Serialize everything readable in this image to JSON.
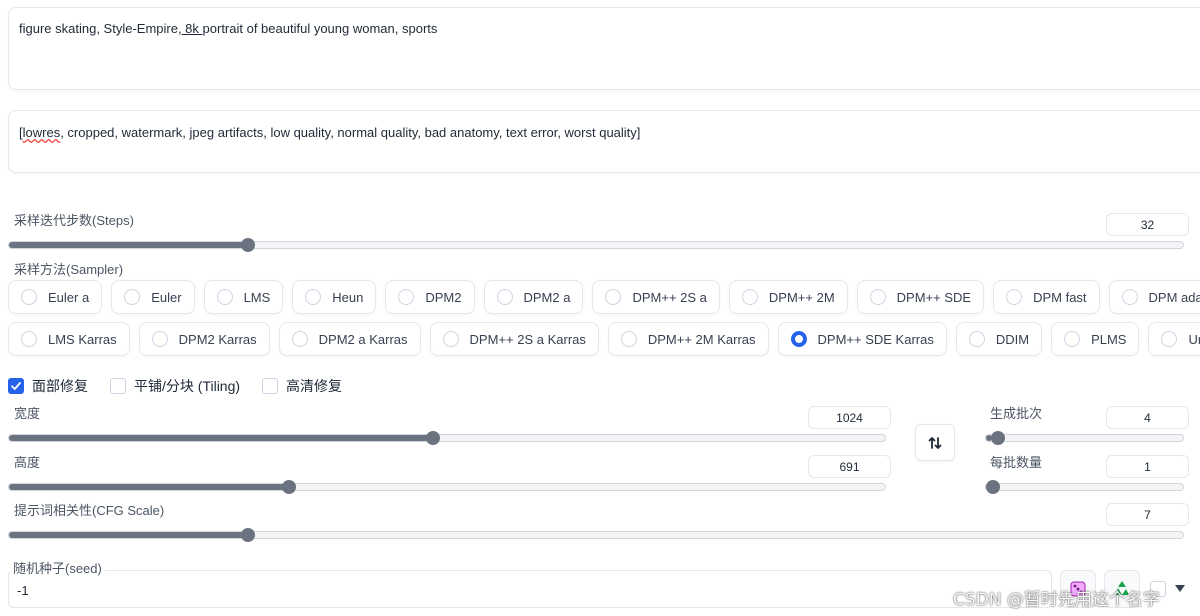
{
  "prompt": {
    "pre": "figure skating, Style-Empire",
    "underlined": ", 8k ",
    "post": "portrait of beautiful young woman, sports"
  },
  "negative_prompt": {
    "pre": "[",
    "misspelled": "lowres",
    "post": ", cropped, watermark, jpeg artifacts, low quality, normal quality, bad anatomy, text error, worst quality]"
  },
  "steps": {
    "label": "采样迭代步数(Steps)",
    "value": "32",
    "fraction": 0.2
  },
  "sampler": {
    "label": "采样方法(Sampler)",
    "selected": "DPM++ SDE Karras",
    "row1": [
      "Euler a",
      "Euler",
      "LMS",
      "Heun",
      "DPM2",
      "DPM2 a",
      "DPM++ 2S a",
      "DPM++ 2M",
      "DPM++ SDE",
      "DPM fast",
      "DPM adaptive"
    ],
    "row2": [
      "LMS Karras",
      "DPM2 Karras",
      "DPM2 a Karras",
      "DPM++ 2S a Karras",
      "DPM++ 2M Karras",
      "DPM++ SDE Karras",
      "DDIM",
      "PLMS",
      "UniPC"
    ]
  },
  "options": {
    "face_restore": {
      "label": "面部修复",
      "checked": true
    },
    "tiling": {
      "label": "平铺/分块 (Tiling)",
      "checked": false
    },
    "hires_fix": {
      "label": "高清修复",
      "checked": false
    }
  },
  "width": {
    "label": "宽度",
    "value": "1024",
    "fraction": 0.484
  },
  "height": {
    "label": "高度",
    "value": "691",
    "fraction": 0.317
  },
  "batch_count": {
    "label": "生成批次",
    "value": "4",
    "fraction": 0.03
  },
  "batch_size": {
    "label": "每批数量",
    "value": "1",
    "fraction": 0.0
  },
  "cfg": {
    "label": "提示词相关性(CFG Scale)",
    "value": "7",
    "fraction": 0.2
  },
  "seed": {
    "label": "随机种子(seed)",
    "value": "-1"
  },
  "icons": {
    "swap": "swap-arrows-icon",
    "dice": "dice-icon",
    "recycle": "recycle-icon"
  },
  "watermark": "CSDN @暂时先用这个名字",
  "colors": {
    "accent": "#2563eb",
    "slider": "#6b7280"
  }
}
